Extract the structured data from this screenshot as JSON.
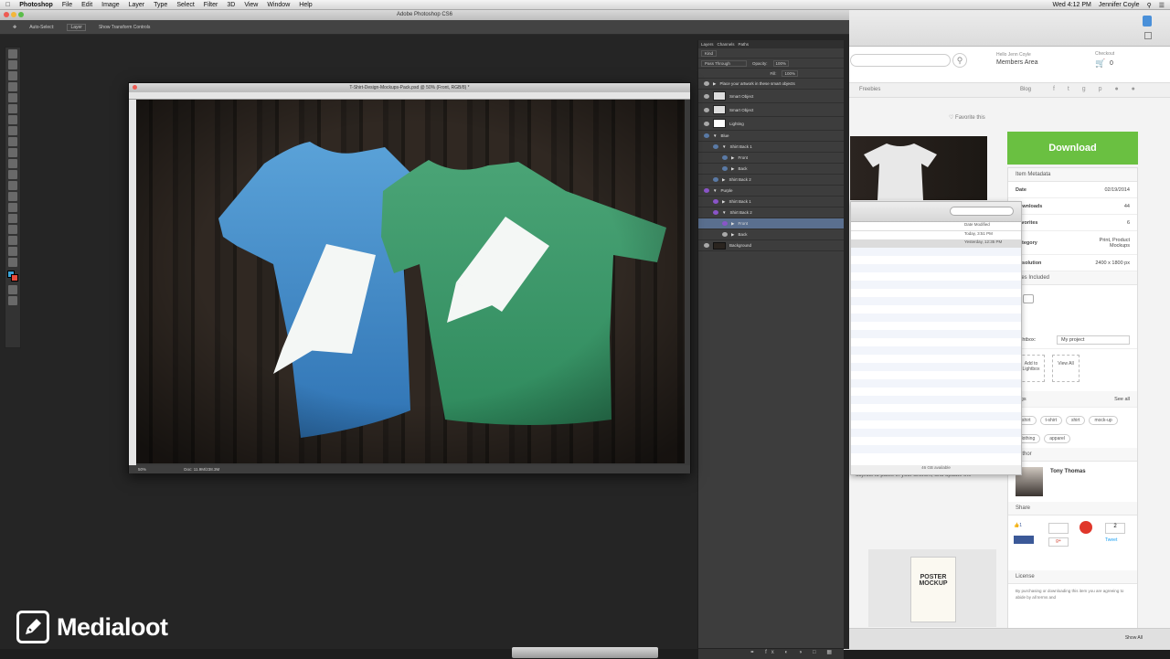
{
  "menubar": {
    "app_name": "Photoshop",
    "items": [
      "File",
      "Edit",
      "Image",
      "Layer",
      "Type",
      "Select",
      "Filter",
      "3D",
      "View",
      "Window",
      "Help"
    ],
    "clock": "Wed 4:12 PM",
    "user": "Jennifer Coyle"
  },
  "photoshop": {
    "window_title": "Adobe Photoshop CS6",
    "options": [
      "Auto-Select:",
      "Layer",
      "Show Transform Controls"
    ],
    "doc_title": "T-Shirt-Design-Mockups-Pack.psd @ 50% (Front, RGB/8) *",
    "doc_status": "Doc: 11.9M/238.3M",
    "zoom": "50%",
    "panel_tabs": [
      "Layers",
      "Channels",
      "Paths"
    ],
    "blend_mode": "Pass Through",
    "opacity_label": "Opacity:",
    "opacity": "100%",
    "fill_label": "Fill:",
    "fill": "100%",
    "layers": [
      {
        "name": "Place your artwork in these smart objects",
        "type": "group",
        "sel": false,
        "purple": false
      },
      {
        "name": "Smart Object",
        "type": "smart",
        "sel": false,
        "purple": false
      },
      {
        "name": "Smart Object",
        "type": "smart",
        "sel": false,
        "purple": false
      },
      {
        "name": "Lighting",
        "type": "layer",
        "sel": false,
        "purple": false
      },
      {
        "name": "Blue",
        "type": "group",
        "sel": false,
        "purple": false
      },
      {
        "name": "Shirt Back 1",
        "type": "group",
        "sel": false,
        "purple": false
      },
      {
        "name": "Front",
        "type": "group",
        "sel": false,
        "purple": false
      },
      {
        "name": "Back",
        "type": "group",
        "sel": false,
        "purple": false
      },
      {
        "name": "Shirt Back 2",
        "type": "group",
        "sel": false,
        "purple": false
      },
      {
        "name": "Purple",
        "type": "group",
        "sel": false,
        "purple": true
      },
      {
        "name": "Shirt Back 1",
        "type": "group",
        "sel": false,
        "purple": true
      },
      {
        "name": "Shirt Back 2",
        "type": "group",
        "sel": false,
        "purple": true
      },
      {
        "name": "Front",
        "type": "group",
        "sel": true,
        "purple": true
      },
      {
        "name": "Back",
        "type": "group",
        "sel": false,
        "purple": false
      },
      {
        "name": "Background",
        "type": "layer",
        "sel": false,
        "purple": false
      }
    ]
  },
  "browser": {
    "account_hint": "Hello Jenn Coyle",
    "account_label": "Members Area",
    "cart_hint": "Checkout",
    "cart_count": "0",
    "nav_freebies": "Freebies",
    "nav_blog": "Blog",
    "favorite": "Favorite this",
    "download": "Download",
    "item_metadata": "Item Metadata",
    "meta": [
      {
        "k": "Date",
        "v": "02/19/2014"
      },
      {
        "k": "Downloads",
        "v": "44"
      },
      {
        "k": "Favorites",
        "v": "6"
      },
      {
        "k": "Category",
        "v": "Print, Product Mockups"
      },
      {
        "k": "Resolution",
        "v": "2400 x 1800 px"
      }
    ],
    "files_included": "Files Included",
    "lightbox_label": "Lightbox:",
    "lightbox_value": "My project",
    "add_to_lightbox": "Add to Lightbox",
    "view_all": "View All",
    "tags_label": "Tags",
    "see_all": "See all",
    "tags": [
      "t-shirt",
      "t-shirt",
      "shirt",
      "mock-up",
      "clothing",
      "apparel"
    ],
    "author_label": "Author",
    "author": "Tony Thomas",
    "share_label": "Share",
    "share_counts": [
      "1",
      "",
      "2"
    ],
    "license_label": "License",
    "license_text": "By purchasing or downloading this item you are agreeing to abide by all terms and",
    "desc_snippet": "objects to paste in your artwork, and update the",
    "show_all": "Show All",
    "poster_title": "POSTER MOCKUP"
  },
  "finder": {
    "col_date": "Date Modified",
    "row1": "Today, 3:51 PM",
    "row2": "Yesterday, 12:35 PM",
    "footer": "46 GB available"
  },
  "logo": {
    "text": "Medialoot"
  }
}
